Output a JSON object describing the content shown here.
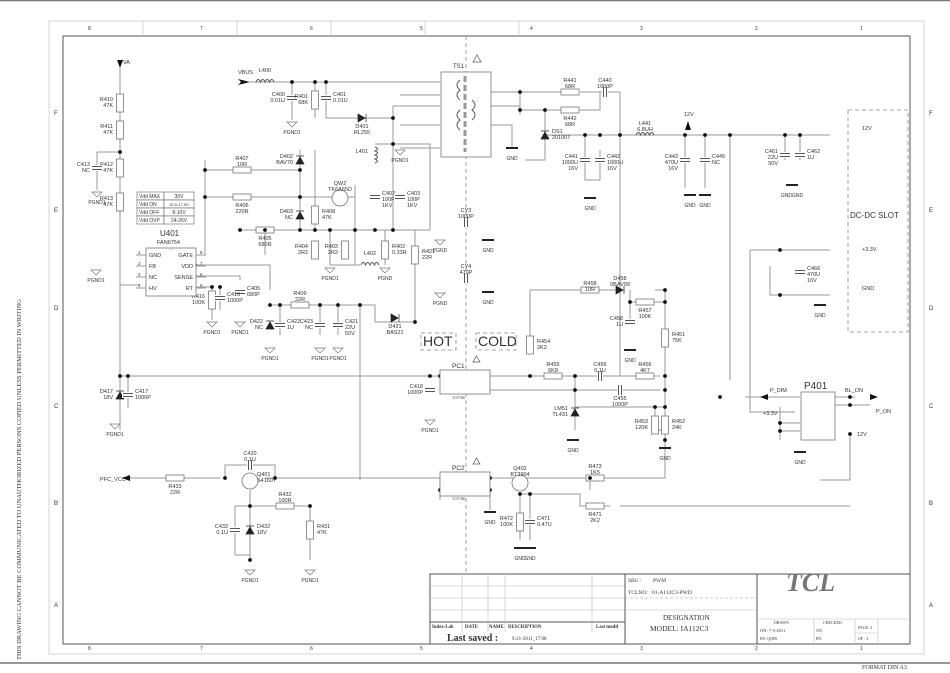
{
  "sheet": {
    "side_notice": "THIS DRAWING CANNOT BE COMMUNICATED TO UNAUTHORIZED PERSONS COPIED UNLESS PERMITTED IN WRITING",
    "column_markers": [
      "8",
      "7",
      "6",
      "5",
      "4",
      "3",
      "2",
      "1"
    ],
    "row_markers": [
      "F",
      "E",
      "D",
      "C",
      "B",
      "A"
    ],
    "format": "FORMAT DIN A3"
  },
  "zones": {
    "hot": "HOT",
    "cold": "COLD",
    "dcdc_slot": "DC-DC SLOT"
  },
  "nets": {
    "va": "VA",
    "vbus": "VBUS",
    "pfc_vcc": "PFC_VCC",
    "v12_out": "12V",
    "v12_slot": "12V",
    "v33_slot": "+3.3V",
    "gnd_slot": "GND",
    "p_dim": "P_DIM",
    "bl_on": "BL_ON",
    "p_on": "P_ON",
    "v33_conn": "+3.3V",
    "v12_conn": "12V"
  },
  "ic": {
    "ref": "U401",
    "part": "FAN6754",
    "pins_left": [
      {
        "num": "1",
        "name": "GND"
      },
      {
        "num": "2",
        "name": "FB"
      },
      {
        "num": "3",
        "name": "NC"
      },
      {
        "num": "4",
        "name": "HV"
      }
    ],
    "pins_right": [
      {
        "num": "8",
        "name": "GATE"
      },
      {
        "num": "7",
        "name": "VDD"
      },
      {
        "num": "6",
        "name": "SENSE"
      },
      {
        "num": "5",
        "name": "RT"
      }
    ]
  },
  "vdd_table": [
    {
      "param": "Vdd MAX",
      "value": "30V"
    },
    {
      "param": "Vdd  ON",
      "value": "15.5-17.5V"
    },
    {
      "param": "Vdd OFF",
      "value": "8-10V"
    },
    {
      "param": "Vdd OVP",
      "value": "24-26V"
    }
  ],
  "components": {
    "R410": {
      "ref": "R410",
      "val": "47K"
    },
    "R411": {
      "ref": "R411",
      "val": "47K"
    },
    "R412": {
      "ref": "R412",
      "val": "47K"
    },
    "R413": {
      "ref": "R413",
      "val": "47K"
    },
    "C413": {
      "ref": "C413",
      "val": "NC"
    },
    "L400": {
      "ref": "L400",
      "val": ""
    },
    "C400": {
      "ref": "C400",
      "val": "0.01U"
    },
    "R401": {
      "ref": "R401",
      "val": "68K"
    },
    "C401": {
      "ref": "C401",
      "val": "0.01U"
    },
    "D401": {
      "ref": "D401",
      "val": "RL255"
    },
    "R407": {
      "ref": "R407",
      "val": "10R"
    },
    "R406": {
      "ref": "R406",
      "val": "220R"
    },
    "D402": {
      "ref": "D402",
      "val": "BAV70"
    },
    "D403": {
      "ref": "D403",
      "val": "NC"
    },
    "R408": {
      "ref": "R408",
      "val": "47K"
    },
    "QW2": {
      "ref": "QW2",
      "val": "TK6A65D"
    },
    "L401": {
      "ref": "L401",
      "val": ""
    },
    "C402": {
      "ref": "C402",
      "val": "100P",
      "extra": "1KV"
    },
    "C403": {
      "ref": "C403",
      "val": "100P",
      "extra": "1KV"
    },
    "R405": {
      "ref": "R405",
      "val": "680R"
    },
    "R404": {
      "ref": "R404",
      "val": "2R2"
    },
    "R403": {
      "ref": "R403",
      "val": "2R2"
    },
    "R402": {
      "ref": "R402",
      "val": "0.33R"
    },
    "L402": {
      "ref": "L402",
      "val": ""
    },
    "R421": {
      "ref": "R421",
      "val": "22R"
    },
    "C405": {
      "ref": "C405",
      "val": "680P"
    },
    "R416": {
      "ref": "R416",
      "val": "100K"
    },
    "C416": {
      "ref": "C416",
      "val": "1000P"
    },
    "R409": {
      "ref": "R409",
      "val": "22R"
    },
    "D422": {
      "ref": "D422",
      "val": "NC"
    },
    "C422": {
      "ref": "C422",
      "val": "1U"
    },
    "C423": {
      "ref": "C423",
      "val": "NC"
    },
    "C421": {
      "ref": "C421",
      "val": "22U",
      "extra": "50V"
    },
    "D421": {
      "ref": "D421",
      "val": "BAS21"
    },
    "D417": {
      "ref": "D417",
      "val": "18V"
    },
    "C417": {
      "ref": "C417",
      "val": "1000P"
    },
    "TS1": {
      "ref": "TS1",
      "val": ""
    },
    "CY3": {
      "ref": "CY3",
      "val": "1000P"
    },
    "CY4": {
      "ref": "CY4",
      "val": "470P"
    },
    "R441": {
      "ref": "R441",
      "val": "68R"
    },
    "R442": {
      "ref": "R442",
      "val": "68R"
    },
    "C440": {
      "ref": "C440",
      "val": "1000P"
    },
    "DS1": {
      "ref": "DS1",
      "val": "20100T"
    },
    "C441": {
      "ref": "C441",
      "val": "1000U",
      "extra": "16V"
    },
    "C442": {
      "ref": "C442",
      "val": "1000U",
      "extra": "16V"
    },
    "L441": {
      "ref": "L441",
      "val": "6.8UH"
    },
    "C443": {
      "ref": "C443",
      "val": "470U",
      "extra": "16V"
    },
    "C445": {
      "ref": "C445",
      "val": "NC"
    },
    "C461": {
      "ref": "C461",
      "val": "22U",
      "extra": "50V"
    },
    "C462": {
      "ref": "C462",
      "val": "1U"
    },
    "C466": {
      "ref": "C466",
      "val": "470U",
      "extra": "16V"
    },
    "R458": {
      "ref": "R458",
      "val": "10R"
    },
    "D458": {
      "ref": "D458",
      "val": "0BAV99"
    },
    "R457": {
      "ref": "R457",
      "val": "100K"
    },
    "C458": {
      "ref": "C458",
      "val": "1U"
    },
    "R451": {
      "ref": "R451",
      "val": "75K"
    },
    "R454": {
      "ref": "R454",
      "val": "2K2"
    },
    "R455": {
      "ref": "R455",
      "val": "6K8"
    },
    "C456": {
      "ref": "C456",
      "val": "0.1U"
    },
    "R456": {
      "ref": "R456",
      "val": "4K7"
    },
    "C455": {
      "ref": "C455",
      "val": "1000P"
    },
    "LM51": {
      "ref": "LM51",
      "val": "TL431"
    },
    "R453": {
      "ref": "R453",
      "val": "120K"
    },
    "R452": {
      "ref": "R452",
      "val": "24K"
    },
    "PC1": {
      "ref": "PC1",
      "val": "TCP785"
    },
    "PC2": {
      "ref": "PC2",
      "val": "TCP785"
    },
    "C418": {
      "ref": "C418",
      "val": "1000P"
    },
    "C420": {
      "ref": "C420",
      "val": "0.1U"
    },
    "Q401": {
      "ref": "Q401",
      "val": "S4160T"
    },
    "R433": {
      "ref": "R433",
      "val": "22R"
    },
    "R432": {
      "ref": "R432",
      "val": "100R"
    },
    "C433": {
      "ref": "C433",
      "val": "0.1U"
    },
    "D432": {
      "ref": "D432",
      "val": "18V"
    },
    "R431": {
      "ref": "R431",
      "val": "47K"
    },
    "Q402": {
      "ref": "Q402",
      "val": "BT3904"
    },
    "R473": {
      "ref": "R473",
      "val": "1K5"
    },
    "R471": {
      "ref": "R471",
      "val": "2K2"
    },
    "R472": {
      "ref": "R472",
      "val": "100K"
    },
    "C471": {
      "ref": "C471",
      "val": "0.47U"
    },
    "P401": {
      "ref": "P401",
      "val": ""
    }
  },
  "ground_labels": {
    "pgnd1": "PGND1",
    "pgnd": "PGND",
    "gnd": "GND",
    "gndgnd": "GNDGND"
  },
  "title_block": {
    "sbu_label": "SBU :",
    "sbu_value": "PWM",
    "tclno_label": "TCLNO:",
    "tclno_value": "01-A112C3-PWD",
    "designation": "DESIGNATION",
    "model": "MODEL: IA112C3",
    "brand": "TCL",
    "revision_headers": [
      "Index-Lab",
      "DATE",
      "NAME",
      "DESCRIPTION",
      "Last modif"
    ],
    "last_saved_label": "Last saved :",
    "last_saved_value": "9-21-2011_17:08",
    "drawn_label": "DRAWN",
    "drawn_on": "ON: 7-5-2011",
    "drawn_by": "BY: QINR",
    "checked_label": "CHECKED",
    "checked_on": "ON:",
    "checked_by": "BY:",
    "page_label": "PAGE: 2",
    "of_label": "OF :  3"
  }
}
